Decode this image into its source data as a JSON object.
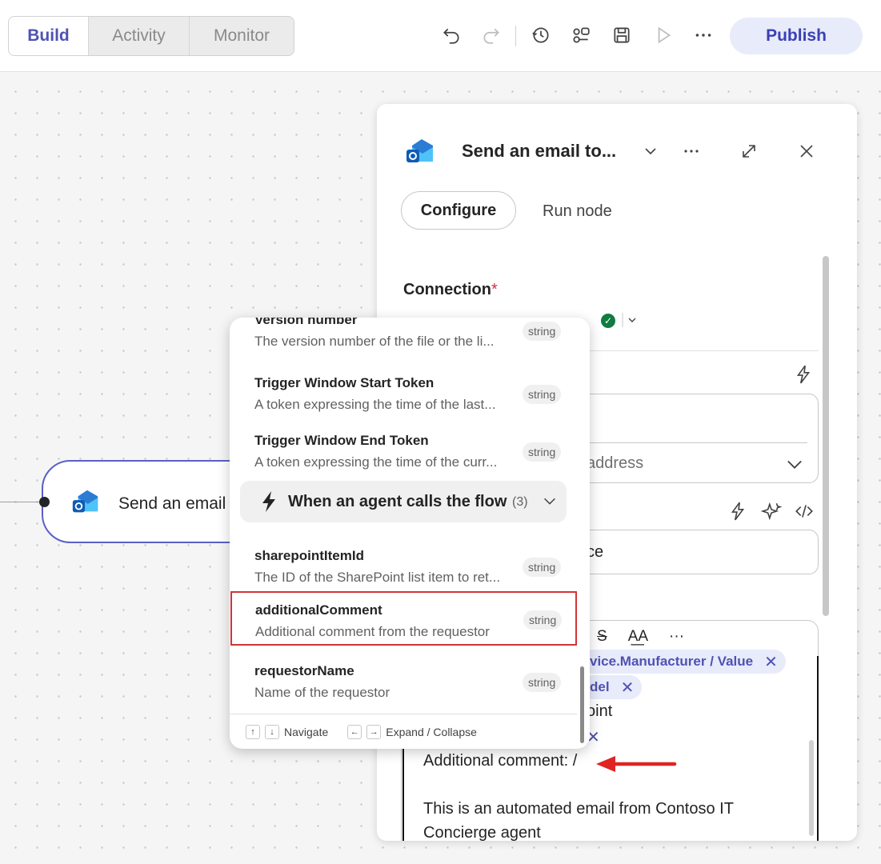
{
  "toolbar": {
    "tabs": [
      {
        "label": "Build",
        "active": true
      },
      {
        "label": "Activity",
        "active": false
      },
      {
        "label": "Monitor",
        "active": false
      }
    ],
    "icons": [
      "undo-icon",
      "redo-icon",
      "history-icon",
      "flow-checker-icon",
      "save-icon",
      "test-run-icon",
      "more-icon"
    ],
    "publish_label": "Publish"
  },
  "canvas": {
    "node": {
      "title": "Send an email t",
      "icon": "outlook-icon"
    }
  },
  "panel": {
    "title": "Send an email to...",
    "tabs": {
      "configure": "Configure",
      "run_node": "Run node"
    },
    "connection": {
      "label": "Connection",
      "required_mark": "*",
      "status": "connected"
    },
    "field1_placeholder": "address",
    "field2_text": "ce",
    "editor": {
      "toolbar": {
        "strikethrough": "S",
        "font_size": "A͟A",
        "more": "···"
      },
      "tokens": [
        {
          "text": "vice.Manufacturer / Value"
        },
        {
          "text": "del"
        },
        {
          "text": ""
        }
      ],
      "line_point": "oint",
      "additional_comment": "Additional comment: /",
      "footer_line1": "This is an automated email from Contoso IT",
      "footer_line2": "Concierge agent"
    }
  },
  "popup": {
    "items_top": [
      {
        "title": "Version number",
        "desc": "The version number of the file or the li...",
        "type": "string"
      },
      {
        "title": "Trigger Window Start Token",
        "desc": "A token expressing the time of the last...",
        "type": "string"
      },
      {
        "title": "Trigger Window End Token",
        "desc": "A token expressing the time of the curr...",
        "type": "string"
      }
    ],
    "group": {
      "label": "When an agent calls the flow",
      "count": "(3)"
    },
    "items_bottom": [
      {
        "title": "sharepointItemId",
        "desc": "The ID of the SharePoint list item to ret...",
        "type": "string"
      },
      {
        "title": "additionalComment",
        "desc": "Additional comment from the requestor",
        "type": "string"
      },
      {
        "title": "requestorName",
        "desc": "Name of the requestor",
        "type": "string"
      }
    ],
    "footer": {
      "navigate": "Navigate",
      "expand": "Expand / Collapse"
    }
  }
}
